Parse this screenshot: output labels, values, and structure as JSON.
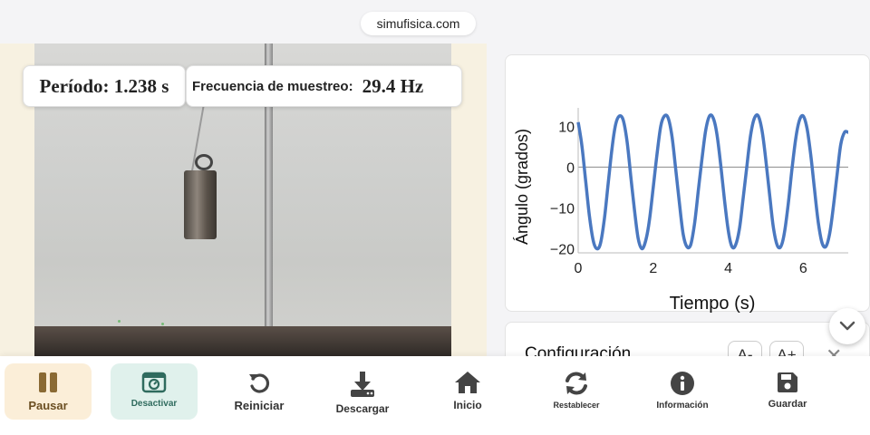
{
  "browser": {
    "url": "simufisica.com"
  },
  "video": {
    "period_text": "Período: 1.238 s",
    "sample_rate_label": "Frecuencia de muestreo:",
    "sample_rate_value": "29.4 Hz"
  },
  "chart_data": {
    "type": "line",
    "xlabel": "Tiempo (s)",
    "ylabel": "Ángulo (grados)",
    "xlim": [
      0,
      7.2
    ],
    "ylim": [
      -21,
      14.5
    ],
    "xticks": [
      0,
      2,
      4,
      6
    ],
    "yticks": [
      10,
      0,
      -10,
      -20
    ],
    "period": 1.238,
    "series": [
      {
        "color": "#4a78c0",
        "x": [
          0,
          0.1,
          0.2,
          0.3,
          0.4,
          0.5,
          0.6,
          0.7,
          0.8,
          0.9,
          1.0,
          1.1,
          1.2,
          1.3,
          1.4,
          1.5,
          1.6,
          1.7,
          1.8,
          1.9,
          2.0,
          2.1,
          2.2,
          2.3,
          2.4,
          2.5,
          2.6,
          2.7,
          2.8,
          2.9,
          3.0,
          3.1,
          3.2,
          3.3,
          3.4,
          3.5,
          3.6,
          3.7,
          3.8,
          3.9,
          4.0,
          4.1,
          4.2,
          4.3,
          4.4,
          4.5,
          4.6,
          4.7,
          4.8,
          4.9,
          5.0,
          5.1,
          5.2,
          5.3,
          5.4,
          5.5,
          5.6,
          5.7,
          5.8,
          5.9,
          6.0,
          6.1,
          6.2,
          6.3,
          6.4,
          6.5,
          6.6,
          6.7,
          6.8,
          6.9,
          7.0,
          7.1,
          7.2
        ],
        "y": [
          11.0,
          5.2,
          -3.5,
          -12.0,
          -18.0,
          -20.0,
          -18.5,
          -12.5,
          -4.0,
          4.5,
          10.5,
          12.5,
          11.5,
          6.5,
          -2.0,
          -10.5,
          -17.5,
          -20.0,
          -18.0,
          -13.0,
          -5.0,
          3.0,
          10.0,
          12.5,
          12.0,
          7.5,
          -0.5,
          -9.0,
          -16.5,
          -19.5,
          -19.0,
          -14.0,
          -6.0,
          2.0,
          9.0,
          12.5,
          12.0,
          8.0,
          0.5,
          -8.0,
          -15.5,
          -19.5,
          -19.0,
          -15.0,
          -7.5,
          0.5,
          8.0,
          12.0,
          12.5,
          9.0,
          2.0,
          -6.5,
          -14.5,
          -19.0,
          -19.5,
          -16.0,
          -9.0,
          -0.5,
          7.0,
          11.5,
          12.5,
          9.5,
          3.0,
          -5.5,
          -13.5,
          -18.5,
          -19.5,
          -16.5,
          -10.0,
          -2.0,
          5.5,
          8.5,
          8.5
        ]
      }
    ]
  },
  "config": {
    "title": "Configuración",
    "font_smaller": "A-",
    "font_larger": "A+"
  },
  "toolbar": {
    "buttons": [
      {
        "label": "Pausar"
      },
      {
        "label": "Desactivar"
      },
      {
        "label": "Reiniciar"
      },
      {
        "label": "Descargar"
      },
      {
        "label": "Inicio"
      },
      {
        "label": "Restablecer"
      },
      {
        "label": "Información"
      },
      {
        "label": "Guardar"
      }
    ]
  },
  "colors": {
    "accent_pause": "#fbeed8",
    "accent_pause_icon": "#8a6a34",
    "accent_camera": "#e0f1ec",
    "accent_camera_icon": "#2f6b5e",
    "icon_gray": "#444444",
    "line": "#4a78c0"
  }
}
